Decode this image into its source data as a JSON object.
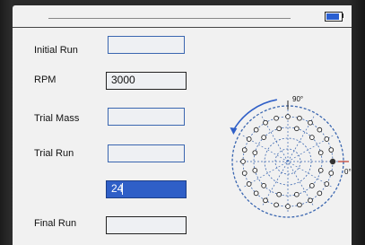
{
  "status": {
    "battery_level": 0.85,
    "battery_icon": "battery-icon"
  },
  "fields": {
    "initial_run": {
      "label": "Initial Run",
      "value": ""
    },
    "rpm": {
      "label": "RPM",
      "value": "3000"
    },
    "trial_mass": {
      "label": "Trial Mass",
      "value": ""
    },
    "trial_run": {
      "label": "Trial Run",
      "value": ""
    },
    "active_input": {
      "value": "24"
    },
    "final_run": {
      "label": "Final Run",
      "value": ""
    }
  },
  "polar": {
    "angle_90_label": "90°",
    "angle_0_label": "0°"
  },
  "colors": {
    "accent_blue": "#2f5fc7",
    "input_border": "#3a66b0",
    "marker_red": "#c0392b"
  }
}
